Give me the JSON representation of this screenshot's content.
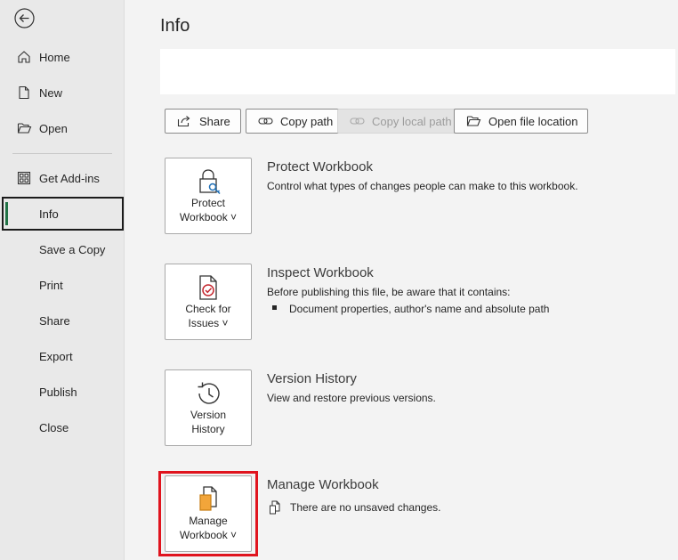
{
  "sidebar": {
    "items": [
      {
        "label": "Home",
        "icon": "home-icon"
      },
      {
        "label": "New",
        "icon": "new-doc-icon"
      },
      {
        "label": "Open",
        "icon": "folder-open-icon"
      },
      {
        "label": "Get Add-ins",
        "icon": "add-ins-grid-icon"
      },
      {
        "label": "Info"
      },
      {
        "label": "Save a Copy"
      },
      {
        "label": "Print"
      },
      {
        "label": "Share"
      },
      {
        "label": "Export"
      },
      {
        "label": "Publish"
      },
      {
        "label": "Close"
      }
    ],
    "selected": "Info"
  },
  "main": {
    "title": "Info",
    "actions": {
      "share": "Share",
      "copy_path": "Copy path",
      "copy_local_path": "Copy local path",
      "open_file_location": "Open file location"
    },
    "sections": {
      "protect": {
        "button_line1": "Protect",
        "button_line2": "Workbook ˅",
        "title": "Protect Workbook",
        "desc": "Control what types of changes people can make to this workbook."
      },
      "inspect": {
        "button_line1": "Check for",
        "button_line2": "Issues ˅",
        "title": "Inspect Workbook",
        "desc": "Before publishing this file, be aware that it contains:",
        "bullet": "Document properties, author's name and absolute path"
      },
      "version": {
        "button_line1": "Version",
        "button_line2": "History",
        "title": "Version History",
        "desc": "View and restore previous versions."
      },
      "manage": {
        "button_line1": "Manage",
        "button_line2": "Workbook ˅",
        "title": "Manage Workbook",
        "desc": "There are no unsaved changes."
      }
    }
  },
  "colors": {
    "accent_green": "#217346",
    "highlight_red": "#e0141e",
    "doc_orange": "#f2a53a"
  }
}
